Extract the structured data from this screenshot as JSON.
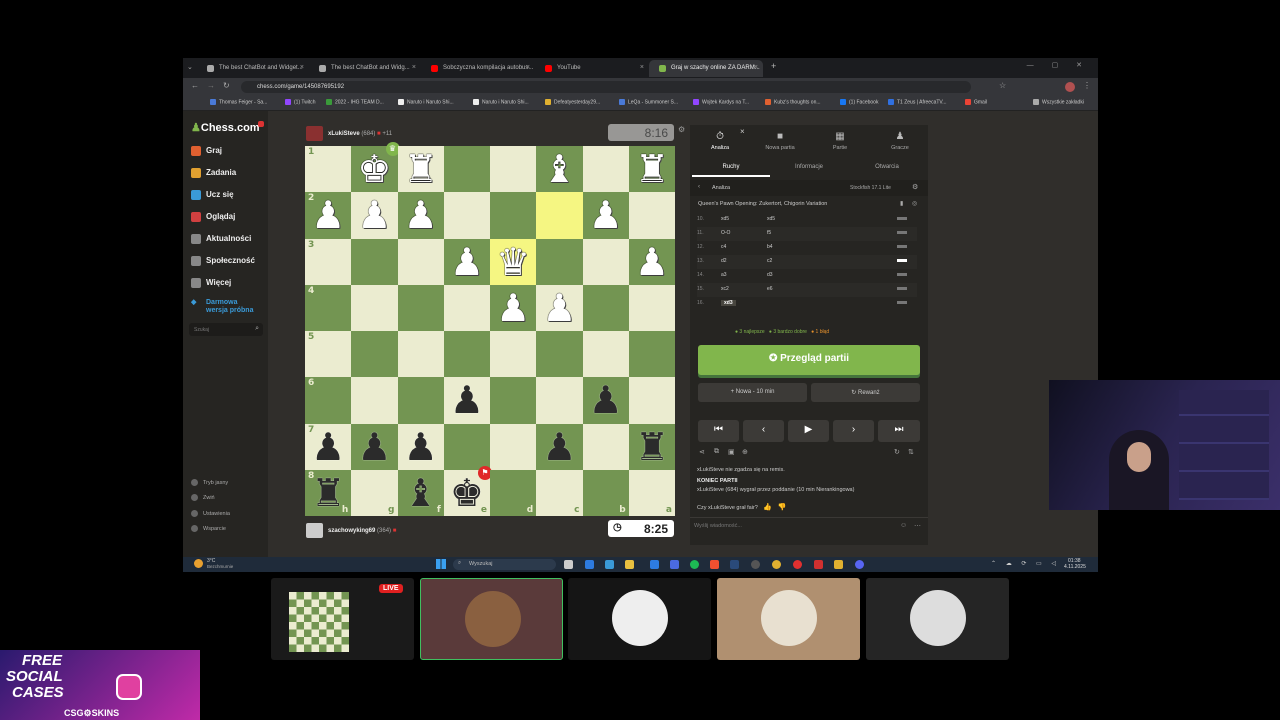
{
  "browser": {
    "tabs": [
      {
        "label": "The best ChatBot and Widget...",
        "color": "#aaa"
      },
      {
        "label": "The best ChatBot and Widg...",
        "color": "#aaa"
      },
      {
        "label": "Sobczyczna kompilacja autobus...",
        "color": "#ff0000"
      },
      {
        "label": "YouTube",
        "color": "#ff0000"
      },
      {
        "label": "Graj w szachy online ZA DARM...",
        "color": "#81b64c"
      }
    ],
    "new_tab": "+",
    "url": "chess.com/game/145087695192",
    "bookmarks": [
      {
        "label": "Thomas Feiger - Sa...",
        "color": "#4a7ad8"
      },
      {
        "label": "(1) Twitch",
        "color": "#9146ff"
      },
      {
        "label": "2022 - IHG TEAM D...",
        "color": "#3a9a3a"
      },
      {
        "label": "Naruto i Naruto Shi...",
        "color": "#eee"
      },
      {
        "label": "Naruto i Naruto Shi...",
        "color": "#eee"
      },
      {
        "label": "Defeatyesterday29...",
        "color": "#e0b030"
      },
      {
        "label": "LeQa - Summoner S...",
        "color": "#4a7ad8"
      },
      {
        "label": "Wojtek Kardys na T...",
        "color": "#9146ff"
      },
      {
        "label": "Kubz's thoughts on...",
        "color": "#e06030"
      },
      {
        "label": "(1) Facebook",
        "color": "#1877f2"
      },
      {
        "label": "T1 Zeus | AfreecaTV...",
        "color": "#3070e0"
      },
      {
        "label": "Gmail",
        "color": "#ea4335"
      }
    ],
    "all_bookmarks": "Wszystkie zakładki"
  },
  "sidebar": {
    "logo": "Chess.com",
    "items": [
      {
        "label": "Graj",
        "color": "#e06030"
      },
      {
        "label": "Zadania",
        "color": "#e0a030"
      },
      {
        "label": "Ucz się",
        "color": "#3a9ad8"
      },
      {
        "label": "Oglądaj",
        "color": "#d04040"
      },
      {
        "label": "Aktualności",
        "color": "#888"
      },
      {
        "label": "Społeczność",
        "color": "#888"
      },
      {
        "label": "Więcej",
        "color": "#888"
      }
    ],
    "trial": "Darmowa wersja próbna",
    "search_placeholder": "Szukaj",
    "bottom": [
      "Tryb jasny",
      "Zwiń",
      "Ustawienia",
      "Wsparcie"
    ]
  },
  "game": {
    "top_player": {
      "name": "xLukiSteve",
      "rating": "(684)",
      "advantage": "+11"
    },
    "top_clock": "8:16",
    "bottom_player": {
      "name": "szachowyking69",
      "rating": "(364)"
    },
    "bottom_clock": "8:25",
    "ranks": [
      "1",
      "2",
      "3",
      "4",
      "5",
      "6",
      "7",
      "8"
    ],
    "files": [
      "h",
      "g",
      "f",
      "e",
      "d",
      "c",
      "b",
      "a"
    ],
    "rows": [
      [
        "",
        "wK",
        "wR",
        "",
        "",
        "wB",
        "",
        "wR"
      ],
      [
        "wP",
        "wP",
        "wP",
        "",
        "",
        "",
        "wP",
        ""
      ],
      [
        "",
        "",
        "",
        "wP",
        "wQ",
        "",
        "",
        "wP"
      ],
      [
        "",
        "",
        "",
        "",
        "wP",
        "wP",
        "",
        ""
      ],
      [
        "",
        "",
        "",
        "",
        "",
        "",
        "",
        ""
      ],
      [
        "",
        "",
        "",
        "bP",
        "",
        "",
        "bP",
        ""
      ],
      [
        "bP",
        "bP",
        "bP",
        "",
        "",
        "bP",
        "",
        "bR"
      ],
      [
        "bR",
        "",
        "bB",
        "bK",
        "",
        "",
        "",
        ""
      ]
    ]
  },
  "panel": {
    "tabs": [
      {
        "label": "Analiza",
        "icon": "⏱"
      },
      {
        "label": "Nowa partia",
        "icon": "■"
      },
      {
        "label": "Partie",
        "icon": "▦"
      },
      {
        "label": "Gracze",
        "icon": "♟"
      }
    ],
    "subtabs": [
      "Ruchy",
      "Informacje",
      "Otwarcia"
    ],
    "analysis_label": "Analiza",
    "engine": "Stockfish 17.1 Lite",
    "opening": "Queen's Pawn Opening: Zukertort, Chigorin Variation",
    "moves": [
      {
        "n": "10.",
        "w": "xd5",
        "b": "xd5"
      },
      {
        "n": "11.",
        "w": "O-O",
        "b": "f5"
      },
      {
        "n": "12.",
        "w": "c4",
        "b": "b4"
      },
      {
        "n": "13.",
        "w": "d2",
        "b": "c2"
      },
      {
        "n": "14.",
        "w": "a3",
        "b": "d3"
      },
      {
        "n": "15.",
        "w": "xc2",
        "b": "e6"
      },
      {
        "n": "16.",
        "w": "xd3",
        "b": ""
      }
    ],
    "stats": [
      "3 najlepsze",
      "3 bardzo dobre",
      "1 błąd"
    ],
    "review": "Przegląd partii",
    "new_game": "Nowa - 10 min",
    "rematch": "Rewanż",
    "chat": [
      "xLukiSteve nie zgadza się na remis.",
      "KONIEC PARTII",
      "xLukiSteve (684) wygrał przez poddanie (10 min Nierankingowa)",
      "Czy xLukiSteve grał fair?"
    ],
    "message_placeholder": "Wyślij wiadomość..."
  },
  "taskbar": {
    "weather_temp": "3°C",
    "weather_desc": "Bezchmurnie",
    "search": "Wyszukaj",
    "time": "01:38",
    "date": "4.11.2025"
  },
  "stream": {
    "live": "LIVE",
    "promo_line1": "FREE",
    "promo_line2": "SOCIAL",
    "promo_line3": "CASES",
    "promo_brand": "CSG⚙SKINS"
  }
}
